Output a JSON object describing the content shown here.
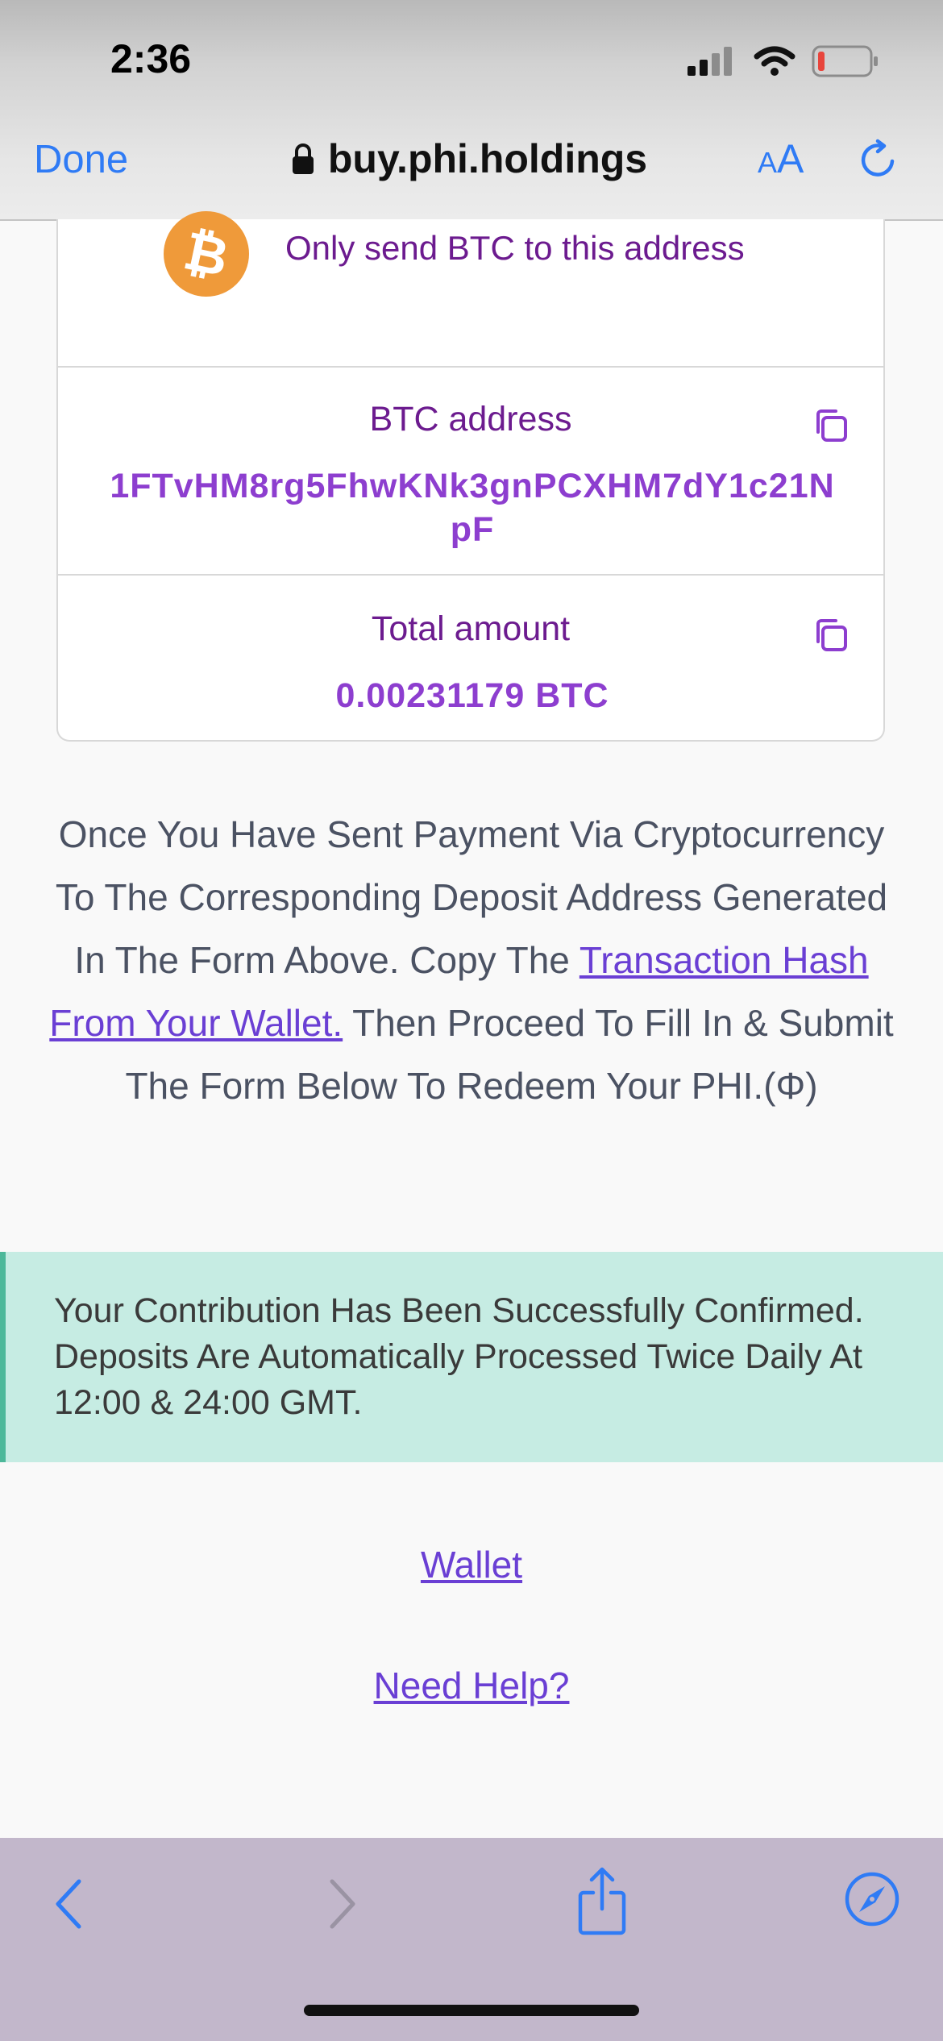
{
  "status_bar": {
    "time": "2:36"
  },
  "browser": {
    "done_label": "Done",
    "url": "buy.phi.holdings",
    "text_size_small": "A",
    "text_size_large": "A",
    "accent_color": "#2f7bf5",
    "icons": [
      "lock-icon",
      "reload-icon",
      "back-icon",
      "forward-icon",
      "share-icon",
      "compass-icon"
    ]
  },
  "card": {
    "notice": "Only send BTC to this address",
    "address_label": "BTC address",
    "address_value": "1FTvHM8rg5FhwKNk3gnPCXHM7dY1c21NpF",
    "amount_label": "Total amount",
    "amount_value": "0.00231179 BTC",
    "label_color": "#6c1b8f",
    "value_color": "#8d3ecf",
    "bitcoin_color": "#ef9a3a"
  },
  "instructions": {
    "part1": "Once You Have Sent Payment Via Cryptocurrency To The Corresponding Deposit Address Generated In The Form Above. Copy The ",
    "link_text": "Transaction Hash From Your Wallet.",
    "part2": " Then Proceed To Fill In & Submit The Form Below To Redeem Your PHI.(Φ)"
  },
  "alert": {
    "message": "Your Contribution Has Been Successfully Confirmed.  Deposits Are Automatically Processed Twice Daily At 12:00 & 24:00 GMT.",
    "background": "#c6ece3"
  },
  "links": {
    "wallet": "Wallet",
    "help": "Need Help?"
  }
}
